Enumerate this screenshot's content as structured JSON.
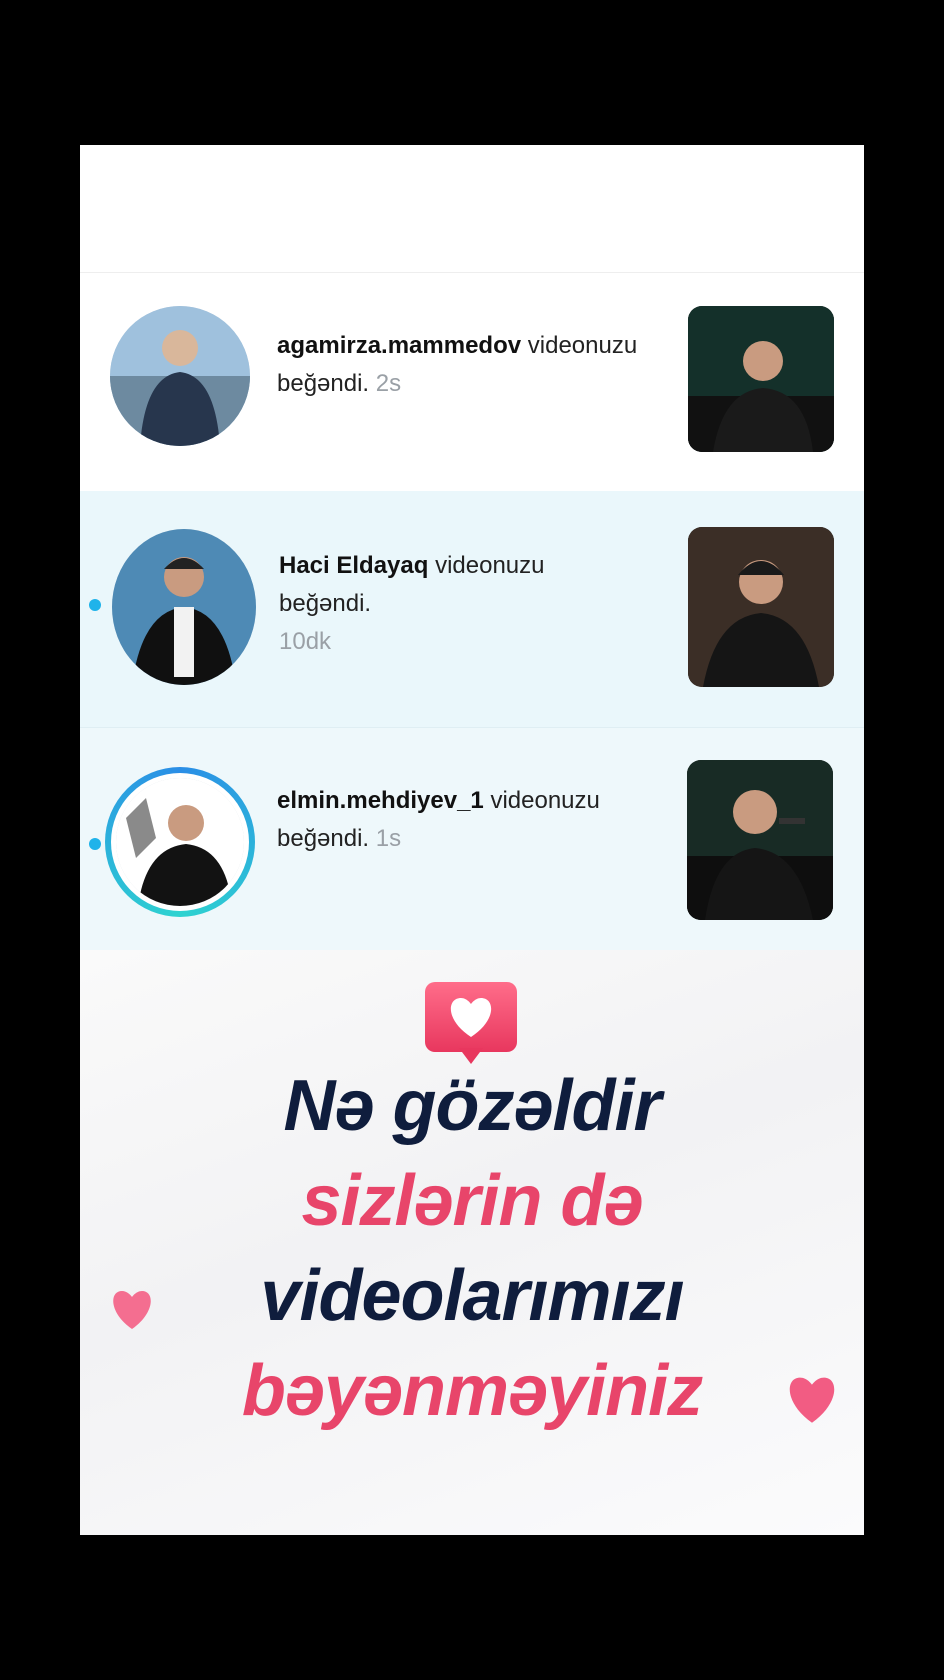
{
  "notifications": [
    {
      "username": "agamirza.mammedov",
      "action": "videonuzu",
      "action2": "beğəndi.",
      "time": "2s",
      "unread": false
    },
    {
      "username": "Haci Eldayaq",
      "action": "videonuzu",
      "action2": "beğəndi.",
      "time": "10dk",
      "unread": true
    },
    {
      "username": "elmin.mehdiyev_1",
      "action": "videonuzu",
      "action2": "beğəndi.",
      "time": "1s",
      "unread": true
    }
  ],
  "promo": {
    "line1": "Nə gözəldir",
    "line2": "sizlərin də",
    "line3": "videolarımızı",
    "line4": "bəyənməyiniz"
  },
  "colors": {
    "accent_pink": "#e8456a",
    "heading_dark": "#0f1d3d",
    "unread_dot": "#1fb3ea"
  }
}
